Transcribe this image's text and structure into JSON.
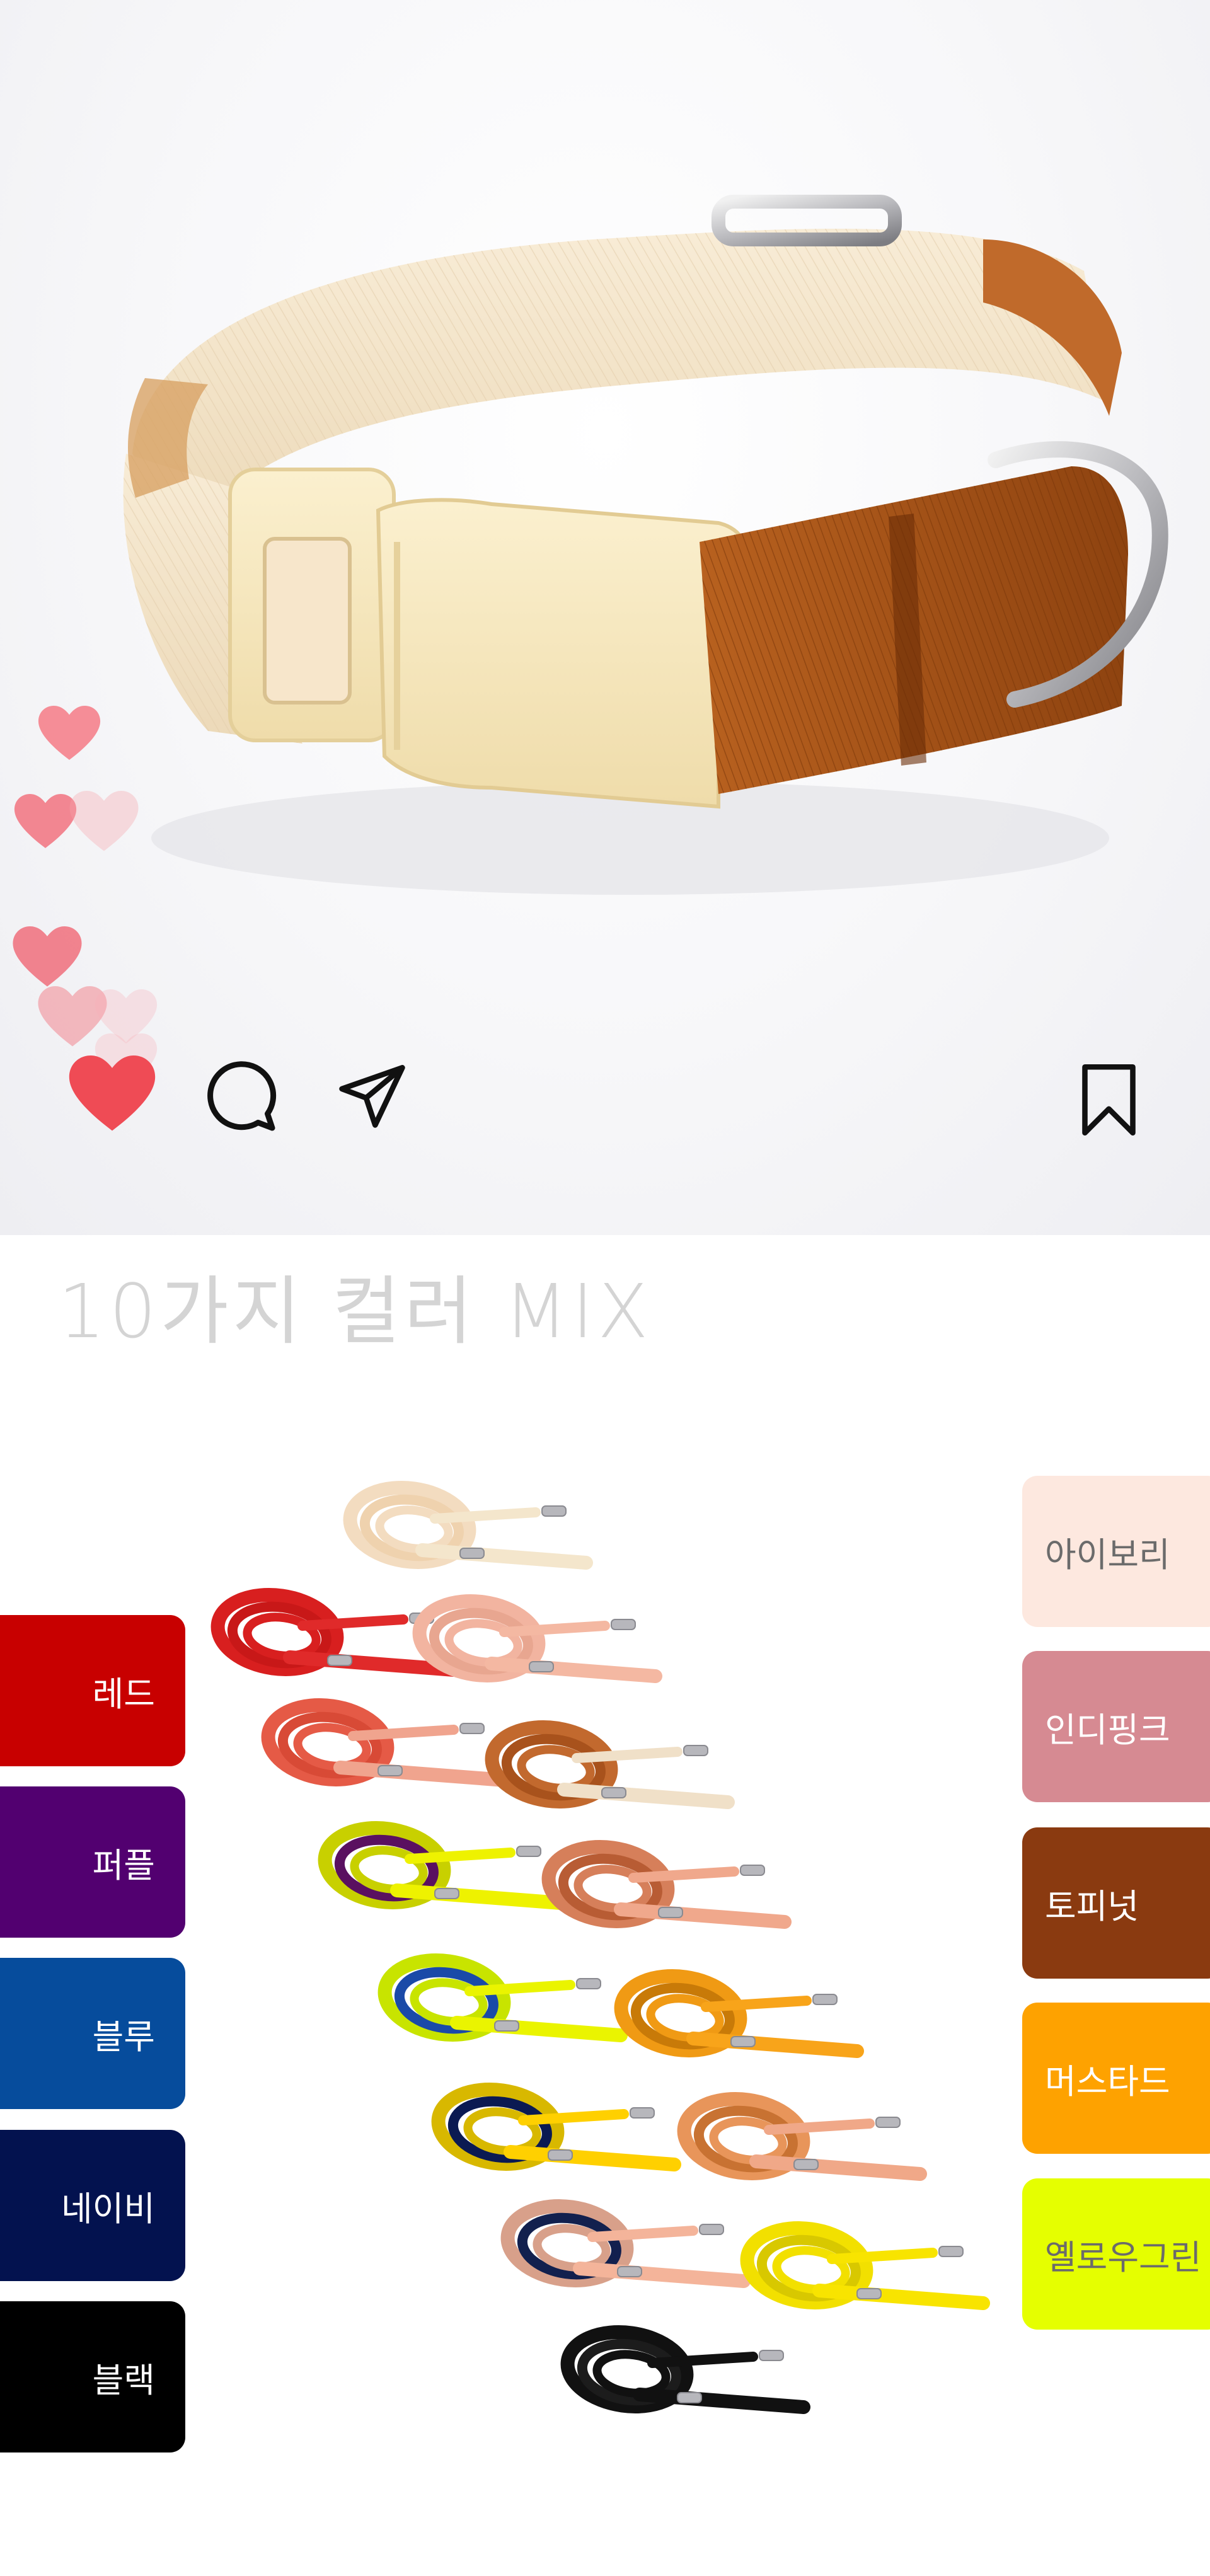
{
  "post": {
    "actions": {
      "like_icon": "heart-filled-icon",
      "comment_icon": "comment-bubble-icon",
      "share_icon": "paper-plane-icon",
      "save_icon": "bookmark-icon"
    },
    "like_color": "#ef4b55"
  },
  "headline": "10가지 컬러 MIX",
  "colors_left": [
    {
      "label": "레드",
      "color": "#c80000"
    },
    {
      "label": "퍼플",
      "color": "#520070"
    },
    {
      "label": "블루",
      "color": "#064c9c"
    },
    {
      "label": "네이비",
      "color": "#03124f"
    },
    {
      "label": "블랙",
      "color": "#000000"
    }
  ],
  "colors_right": [
    {
      "label": "아이보리",
      "color": "#fde8df",
      "text_color": "#6b6b6b"
    },
    {
      "label": "인디핑크",
      "color": "#d68a92",
      "text_color": "#ffffff"
    },
    {
      "label": "토피넛",
      "color": "#8a3a10",
      "text_color": "#ffffff"
    },
    {
      "label": "머스타드",
      "color": "#fea200",
      "text_color": "#ffffff"
    },
    {
      "label": "옐로우그린",
      "color": "#e5ff00",
      "text_color": "#6b6b6b"
    }
  ]
}
